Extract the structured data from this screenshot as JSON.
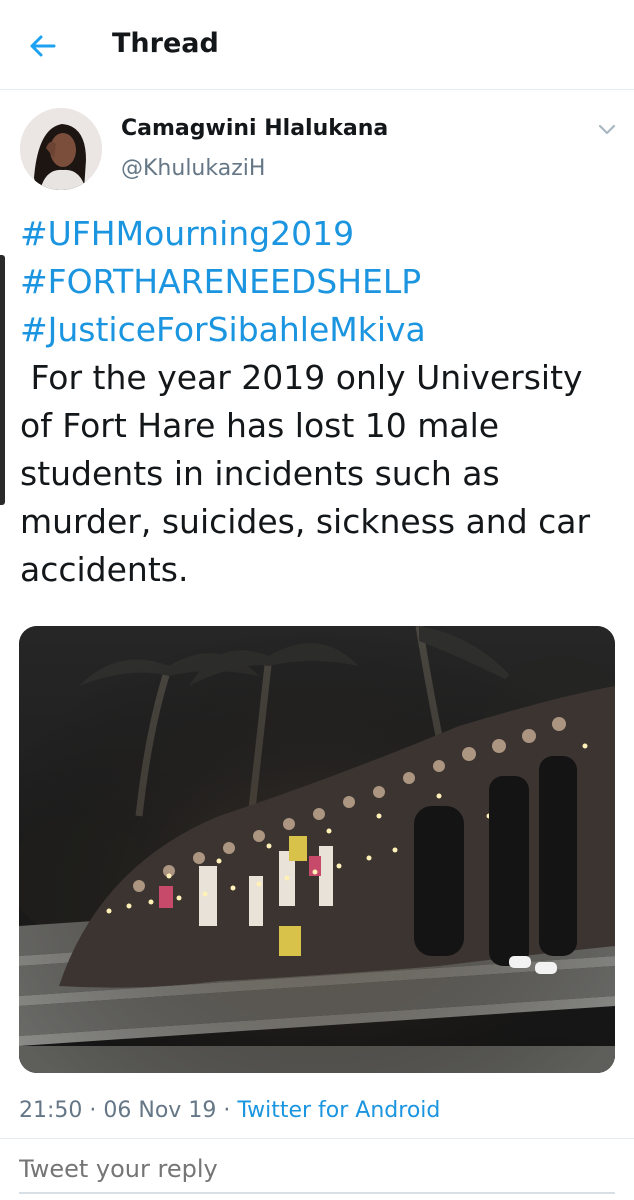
{
  "header": {
    "title": "Thread",
    "back_icon": "arrow-left-icon",
    "accent": "#1da1f2"
  },
  "tweet": {
    "author_name": "Camagwini Hlalukana",
    "author_handle": "@KhulukaziH",
    "hashtags": [
      "#UFHMourning2019",
      "#FORTHARENEEDSHELP",
      "#JusticeForSibahleMkiva"
    ],
    "body_lines": [
      " For the year 2019 only University",
      "of Fort Hare has lost 10 male",
      "students in incidents such as",
      "murder, suicides, sickness and car",
      "accidents."
    ],
    "time": "21:50",
    "date": "06 Nov 19",
    "source": "Twitter for Android",
    "hashtag_color": "#1b95e0"
  },
  "reply": {
    "placeholder": "Tweet your reply"
  }
}
